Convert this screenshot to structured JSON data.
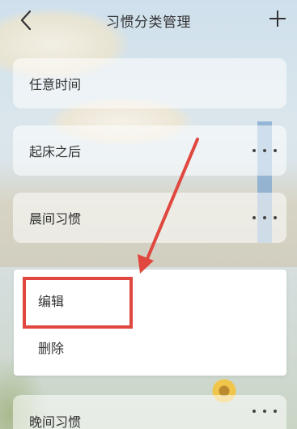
{
  "header": {
    "title": "习惯分类管理",
    "back_icon": "chevron-left-icon",
    "add_icon": "plus-icon"
  },
  "categories": [
    {
      "label": "任意时间",
      "has_more": false
    },
    {
      "label": "起床之后",
      "has_more": true
    },
    {
      "label": "晨间习惯",
      "has_more": true
    },
    {
      "label": "晚间习惯",
      "has_more": true
    }
  ],
  "menu": {
    "items": [
      {
        "label": "编辑"
      },
      {
        "label": "删除"
      }
    ]
  },
  "annotation": {
    "highlight_color": "#e0473e",
    "arrow_color": "#e0473e"
  }
}
